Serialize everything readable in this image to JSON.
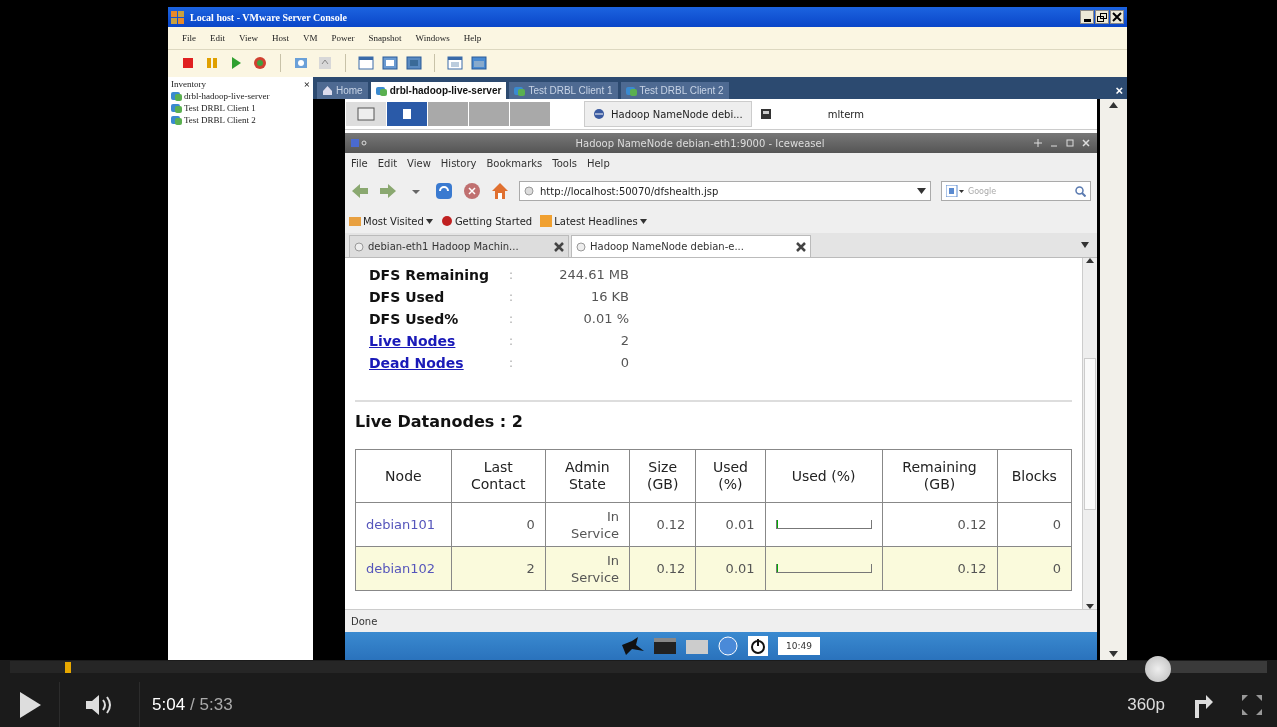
{
  "vm_window": {
    "title": "Local host - VMware Server Console",
    "menu": [
      "File",
      "Edit",
      "View",
      "Host",
      "VM",
      "Power",
      "Snapshot",
      "Windows",
      "Help"
    ]
  },
  "inventory": {
    "title": "Inventory",
    "close": "×",
    "items": [
      "drbl-hadoop-live-server",
      "Test DRBL Client 1",
      "Test DRBL Client 2"
    ]
  },
  "console_tabs": [
    {
      "label": "Home",
      "selected": false
    },
    {
      "label": "drbl-hadoop-live-server",
      "selected": true
    },
    {
      "label": "Test DRBL Client 1",
      "selected": false
    },
    {
      "label": "Test DRBL Client 2",
      "selected": false
    }
  ],
  "console_close": "×",
  "guest_panel": {
    "tasks": [
      {
        "label": "Hadoop NameNode debi...",
        "selected": true
      },
      {
        "label": "mlterm",
        "selected": false
      }
    ]
  },
  "browser": {
    "title": "Hadoop NameNode debian-eth1:9000 - Iceweasel",
    "menu": [
      "File",
      "Edit",
      "View",
      "History",
      "Bookmarks",
      "Tools",
      "Help"
    ],
    "url": "http://localhost:50070/dfshealth.jsp",
    "search_placeholder": "Google",
    "bookmarks": [
      {
        "label": "Most Visited",
        "dropdown": true
      },
      {
        "label": "Getting Started",
        "dropdown": false
      },
      {
        "label": "Latest Headlines",
        "dropdown": true
      }
    ],
    "tabs": [
      {
        "label": "debian-eth1 Hadoop Machin...",
        "selected": false
      },
      {
        "label": "Hadoop NameNode debian-e...",
        "selected": true
      }
    ],
    "status": "Done"
  },
  "page": {
    "stats": [
      {
        "label": "DFS Remaining",
        "colon": ":",
        "value": "244.61 MB",
        "link": false
      },
      {
        "label": "DFS Used",
        "colon": ":",
        "value": "16 KB",
        "link": false
      },
      {
        "label": "DFS Used%",
        "colon": ":",
        "value": "0.01 %",
        "link": false
      },
      {
        "label": "Live Nodes",
        "colon": ":",
        "value": "2",
        "link": true
      },
      {
        "label": "Dead Nodes",
        "colon": ":",
        "value": "0",
        "link": true
      }
    ],
    "heading": "Live Datanodes : 2",
    "table": {
      "columns": [
        "Node",
        "Last Contact",
        "Admin State",
        "Size (GB)",
        "Used (%)",
        "Used (%)",
        "Remaining (GB)",
        "Blocks"
      ],
      "rows": [
        {
          "node": "debian101",
          "last_contact": "0",
          "admin_state": "In Service",
          "size": "0.12",
          "used_pct": "0.01",
          "usage": {
            "level": 0.01
          },
          "remaining": "0.12",
          "blocks": "0",
          "highlighted": false
        },
        {
          "node": "debian102",
          "last_contact": "2",
          "admin_state": "In Service",
          "size": "0.12",
          "used_pct": "0.01",
          "usage": {
            "level": 0.01
          },
          "remaining": "0.12",
          "blocks": "0",
          "highlighted": true
        }
      ]
    }
  },
  "guest_clock": "10:49",
  "player": {
    "progress": {
      "level": 0.913
    },
    "time_current": "5:04",
    "time_total": "/ 5:33",
    "quality": "360p"
  }
}
